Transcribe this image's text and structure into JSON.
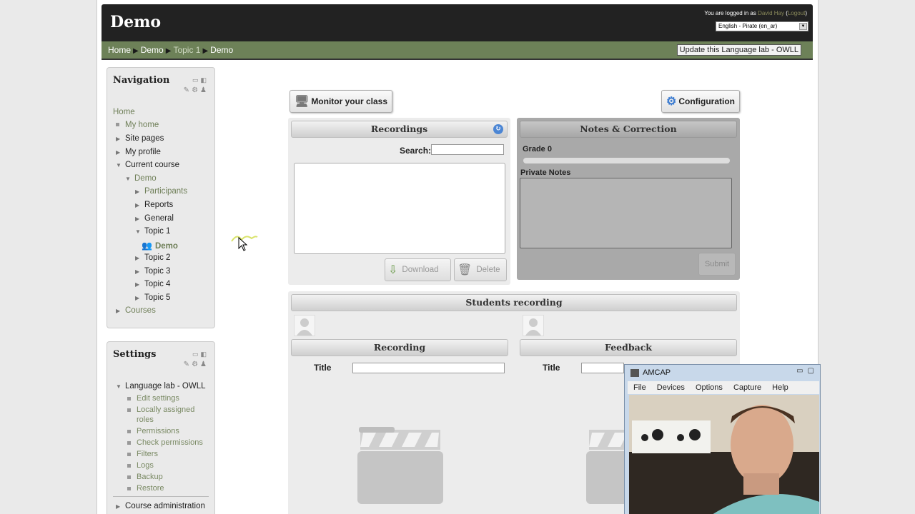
{
  "site": {
    "title": "Demo",
    "login_prefix": "You are logged in as ",
    "user_name": "David Hay",
    "logout_label": "Logout",
    "language": "English - Pirate (en_ar)"
  },
  "breadcrumb": [
    "Home",
    "Demo",
    "Topic 1",
    "Demo"
  ],
  "update_button": "Update this Language lab - OWLL",
  "navigation": {
    "title": "Navigation",
    "items": [
      "Home",
      "My home",
      "Site pages",
      "My profile",
      "Current course",
      "Demo",
      "Participants",
      "Reports",
      "General",
      "Topic 1",
      "Demo",
      "Topic 2",
      "Topic 3",
      "Topic 4",
      "Topic 5",
      "Courses"
    ]
  },
  "settings": {
    "title": "Settings",
    "section": "Language lab - OWLL",
    "links": [
      "Edit settings",
      "Locally assigned",
      "roles",
      "Permissions",
      "Check permissions",
      "Filters",
      "Logs",
      "Backup",
      "Restore"
    ],
    "course_admin": "Course administration"
  },
  "main": {
    "monitor_btn": "Monitor your class",
    "config_btn": "Configuration",
    "recordings_title": "Recordings",
    "search_label": "Search:",
    "download_btn": "Download",
    "delete_btn": "Delete",
    "notes_title": "Notes & Correction",
    "grade_label": "Grade 0",
    "private_notes_label": "Private Notes",
    "submit_btn": "Submit",
    "students_title": "Students recording",
    "recording_title": "Recording",
    "feedback_title": "Feedback",
    "title_label": "Title"
  },
  "amcap": {
    "title": "AMCAP",
    "menu": [
      "File",
      "Devices",
      "Options",
      "Capture",
      "Help"
    ]
  }
}
